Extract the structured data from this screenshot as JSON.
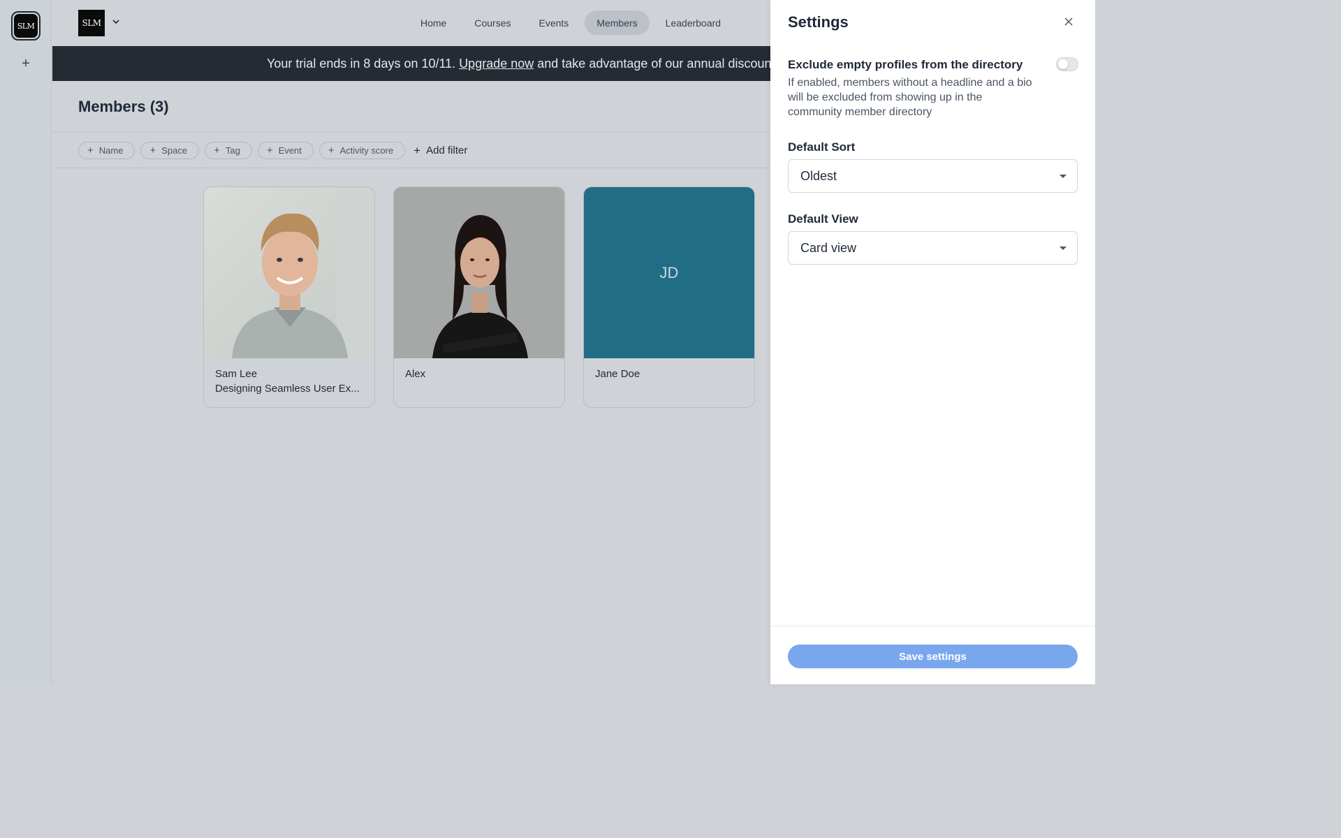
{
  "rail": {
    "logo_text": "SLM",
    "add_icon": "plus-icon"
  },
  "header": {
    "brand_logo_text": "SLM",
    "brand_chevron_icon": "chevron-down-icon",
    "nav": [
      {
        "label": "Home",
        "active": false
      },
      {
        "label": "Courses",
        "active": false
      },
      {
        "label": "Events",
        "active": false
      },
      {
        "label": "Members",
        "active": true
      },
      {
        "label": "Leaderboard",
        "active": false
      }
    ]
  },
  "banner": {
    "prefix": "Your trial ends in 8 days on 10/11.",
    "link": "Upgrade now",
    "suffix": "and take advantage of our annual discounts"
  },
  "page": {
    "title": "Members (3)"
  },
  "filters": {
    "chips": [
      "Name",
      "Space",
      "Tag",
      "Event",
      "Activity score"
    ],
    "add_label": "Add filter"
  },
  "members": [
    {
      "name": "Sam Lee",
      "headline": "Designing Seamless User Ex...",
      "photo": "man-portrait"
    },
    {
      "name": "Alex",
      "headline": "",
      "photo": "woman-portrait"
    },
    {
      "name": "Jane Doe",
      "headline": "",
      "initials": "JD",
      "color": "#216d86"
    }
  ],
  "settings": {
    "title": "Settings",
    "close_icon": "close-icon",
    "exclude": {
      "label": "Exclude empty profiles from the directory",
      "description": "If enabled, members without a headline and a bio will be excluded from showing up in the community member directory",
      "enabled": false
    },
    "default_sort": {
      "label": "Default Sort",
      "value": "Oldest"
    },
    "default_view": {
      "label": "Default View",
      "value": "Card view"
    },
    "save_label": "Save settings",
    "save_color": "#79a7ee"
  }
}
